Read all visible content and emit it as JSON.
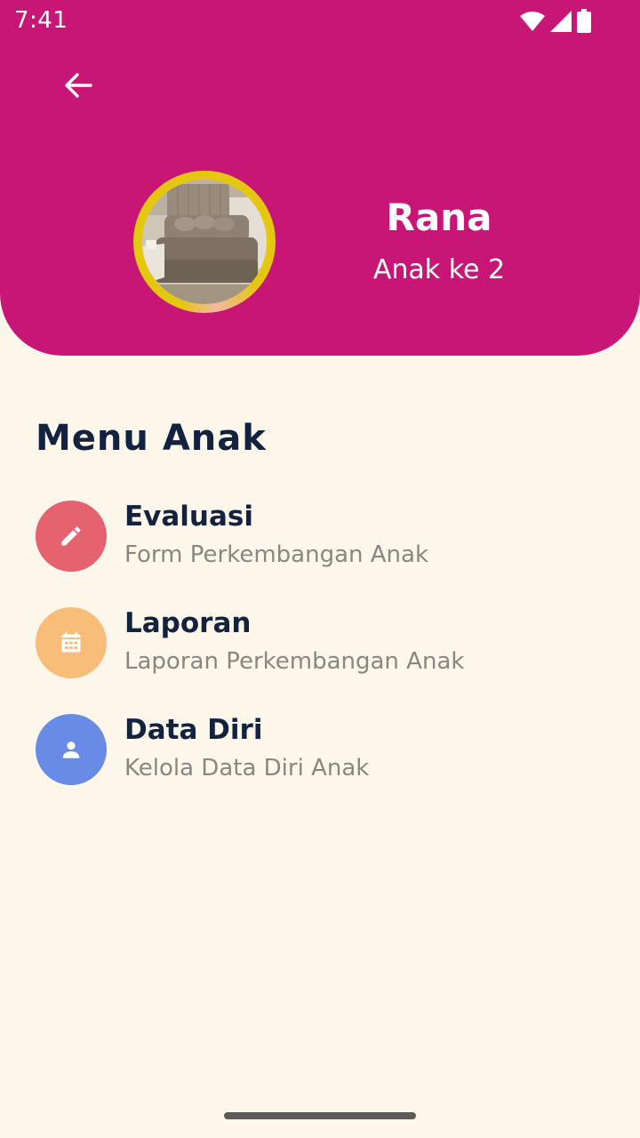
{
  "status_bar": {
    "time": "7:41",
    "icons": [
      "wifi-icon",
      "signal-icon",
      "battery-icon"
    ]
  },
  "header": {
    "back_icon": "arrow-left-icon",
    "child_name": "Rana",
    "child_order": "Anak ke 2"
  },
  "menu": {
    "title": "Menu Anak",
    "items": [
      {
        "icon": "pencil-icon",
        "color": "#E5626F",
        "title": "Evaluasi",
        "subtitle": "Form Perkembangan Anak"
      },
      {
        "icon": "calendar-icon",
        "color": "#F8BE79",
        "title": "Laporan",
        "subtitle": "Laporan Perkembangan Anak"
      },
      {
        "icon": "person-icon",
        "color": "#688CE6",
        "title": "Data Diri",
        "subtitle": "Kelola Data Diri Anak"
      }
    ]
  },
  "colors": {
    "header": "#C81677",
    "background": "#FDF7EB",
    "heading_text": "#13233F",
    "subtitle_text": "#8A8782",
    "avatar_ring": "#E4C70F"
  }
}
